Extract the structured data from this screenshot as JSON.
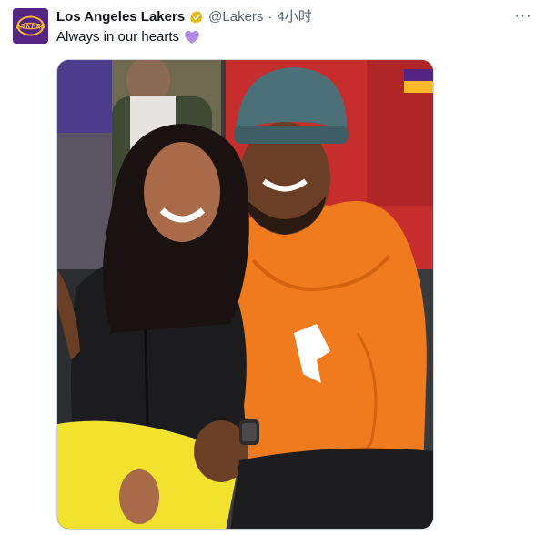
{
  "account": {
    "display_name": "Los Angeles Lakers",
    "handle": "@Lakers",
    "separator": "·",
    "timestamp": "4小时",
    "verified_badge_color": "#e2b719",
    "avatar_bg": "#552583",
    "avatar_logo_color": "#fdb927",
    "avatar_logo_text": "LAKERS"
  },
  "tweet": {
    "text": "Always in our hearts",
    "emoji_icon": "purple-heart-icon",
    "emoji_color": "#b48de3"
  },
  "more_menu": {
    "label": "···"
  },
  "media": {
    "type": "photo",
    "flag_colors": [
      "#552583",
      "#fdb927"
    ]
  }
}
